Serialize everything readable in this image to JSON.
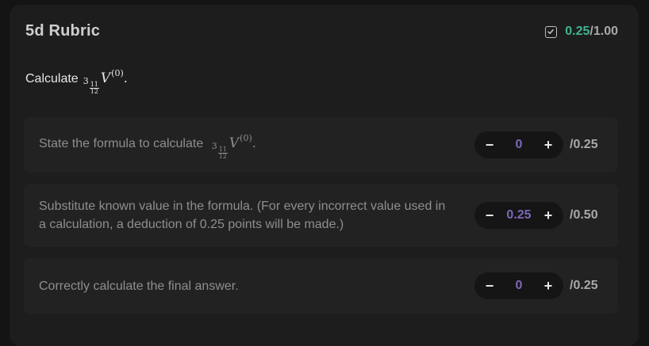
{
  "rubric": {
    "title": "5d Rubric",
    "score_awarded": "0.25",
    "score_total": "/1.00",
    "score_icon": "checkbox-checked-icon",
    "colors": {
      "awarded": "#3fb591",
      "stepper_value": "#7f67b8"
    },
    "prompt": {
      "text": "Calculate",
      "math": {
        "prefix": "3",
        "frac_num": "11",
        "frac_den": "12",
        "symbol": "V",
        "superscript": "(0)",
        "suffix": "."
      }
    },
    "criteria": [
      {
        "text": "State the formula to calculate",
        "math": {
          "prefix": "3",
          "frac_num": "11",
          "frac_den": "12",
          "symbol": "V",
          "superscript": "(0)",
          "suffix": "."
        },
        "value": "0",
        "max": "/0.25",
        "decrement": "−",
        "increment": "+"
      },
      {
        "text": "Substitute known value in the formula. (For every incorrect value used in a calculation, a deduction of 0.25 points will be made.)",
        "value": "0.25",
        "max": "/0.50",
        "decrement": "−",
        "increment": "+"
      },
      {
        "text": "Correctly calculate the final answer.",
        "value": "0",
        "max": "/0.25",
        "decrement": "−",
        "increment": "+"
      }
    ]
  }
}
